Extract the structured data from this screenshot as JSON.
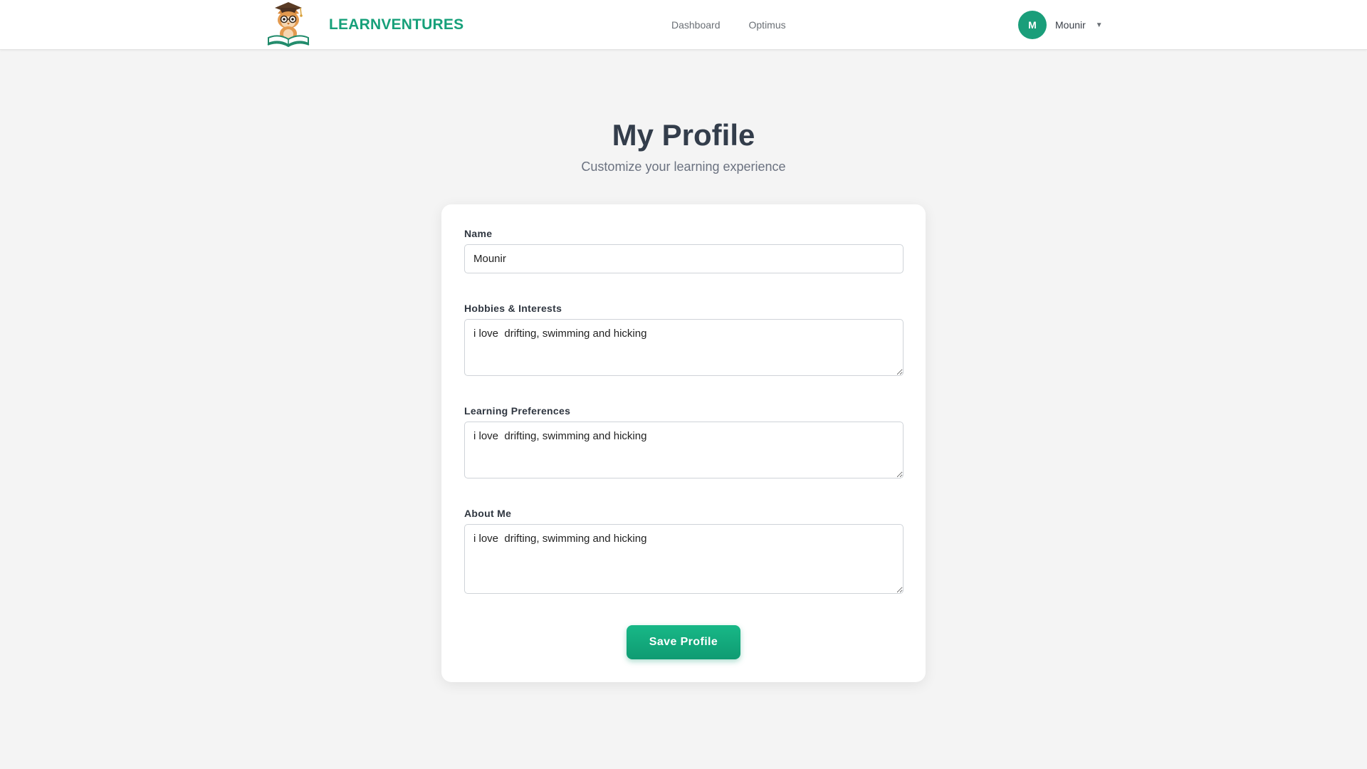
{
  "brand": {
    "name": "LEARNVENTURES",
    "logo_icon": "owl-graduate-reading-book-icon",
    "accent_color": "#17a07a"
  },
  "nav": {
    "links": [
      {
        "label": "Dashboard"
      },
      {
        "label": "Optimus"
      }
    ]
  },
  "user": {
    "initial": "M",
    "name": "Mounir",
    "avatar_color": "#1a9e7a",
    "caret": "▼"
  },
  "header": {
    "title": "My Profile",
    "subtitle": "Customize your learning experience"
  },
  "form": {
    "name": {
      "label": "Name",
      "value": "Mounir"
    },
    "hobbies": {
      "label": "Hobbies & Interests",
      "value": "i love  drifting, swimming and hicking"
    },
    "preferences": {
      "label": "Learning Preferences",
      "value": "i love  drifting, swimming and hicking"
    },
    "about": {
      "label": "About Me",
      "value": "i love  drifting, swimming and hicking"
    },
    "save_label": "Save Profile"
  }
}
